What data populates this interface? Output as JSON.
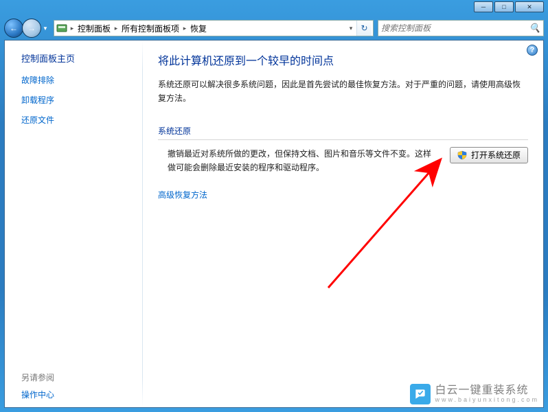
{
  "window": {
    "minimize_glyph": "─",
    "maximize_glyph": "□",
    "close_glyph": "✕"
  },
  "nav": {
    "back_glyph": "←",
    "forward_glyph": "→",
    "dropdown_glyph": "▼"
  },
  "breadcrumb": {
    "sep": "▸",
    "items": [
      "控制面板",
      "所有控制面板项",
      "恢复"
    ],
    "dropdown_glyph": "▾",
    "refresh_glyph": "↻"
  },
  "search": {
    "placeholder": "搜索控制面板",
    "icon": "🔍"
  },
  "sidebar": {
    "home": "控制面板主页",
    "links": [
      "故障排除",
      "卸载程序",
      "还原文件"
    ],
    "see_also_label": "另请参阅",
    "see_also_link": "操作中心"
  },
  "content": {
    "help_glyph": "?",
    "title": "将此计算机还原到一个较早的时间点",
    "description": "系统还原可以解决很多系统问题，因此是首先尝试的最佳恢复方法。对于严重的问题，请使用高级恢复方法。",
    "section_title": "系统还原",
    "section_text": "撤销最近对系统所做的更改，但保持文档、图片和音乐等文件不变。这样做可能会删除最近安装的程序和驱动程序。",
    "action_button": "打开系统还原",
    "advanced_link": "高级恢复方法"
  },
  "watermark": {
    "cn": "白云一键重装系统",
    "en": "www.baiyunxitong.com"
  }
}
